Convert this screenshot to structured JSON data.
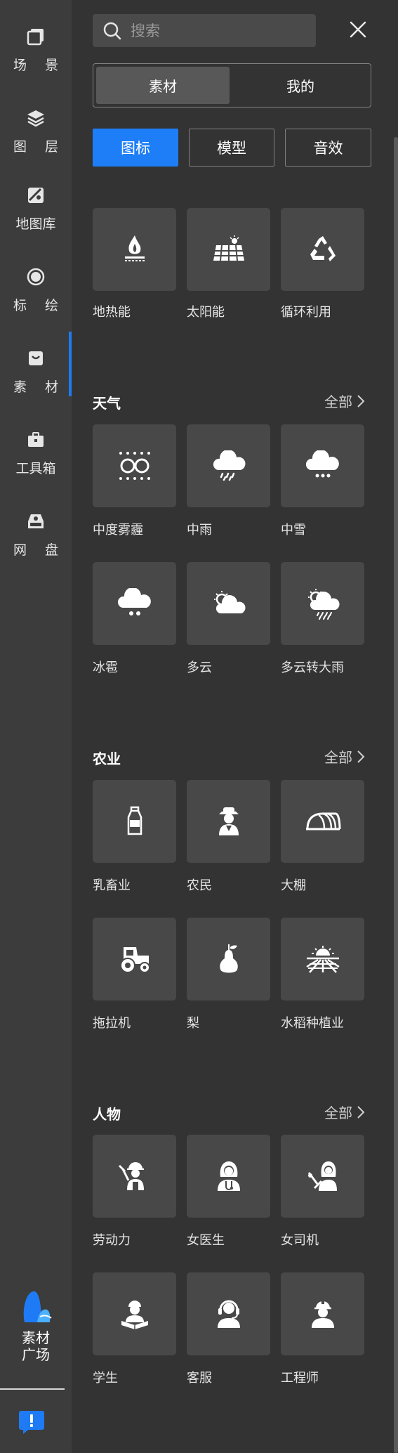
{
  "rail": {
    "items": [
      {
        "label": "场 景",
        "icon": "scene-icon"
      },
      {
        "label": "图 层",
        "icon": "layers-icon"
      },
      {
        "label": "地图库",
        "icon": "map-library-icon"
      },
      {
        "label": "标 绘",
        "icon": "plot-icon"
      },
      {
        "label": "素 材",
        "icon": "material-bag-icon",
        "active": true
      },
      {
        "label": "工具箱",
        "icon": "toolbox-icon"
      },
      {
        "label": "网 盘",
        "icon": "cloud-drive-icon"
      }
    ],
    "plaza": {
      "label_line1": "素材",
      "label_line2": "广场"
    },
    "accent_color": "#1e7bf5"
  },
  "search": {
    "placeholder": "搜索"
  },
  "segmented": {
    "options": [
      "素材",
      "我的"
    ],
    "selected": "素材"
  },
  "type_tabs": {
    "items": [
      "图标",
      "模型",
      "音效"
    ],
    "selected": "图标",
    "accent_color": "#1e7ef7"
  },
  "top_group": {
    "items": [
      {
        "label": "地热能",
        "icon": "geothermal-icon"
      },
      {
        "label": "太阳能",
        "icon": "solar-panel-icon"
      },
      {
        "label": "循环利用",
        "icon": "recycle-icon"
      }
    ]
  },
  "sections": [
    {
      "title": "天气",
      "all_label": "全部",
      "items": [
        {
          "label": "中度雾霾",
          "icon": "haze-icon"
        },
        {
          "label": "中雨",
          "icon": "moderate-rain-icon"
        },
        {
          "label": "中雪",
          "icon": "moderate-snow-icon"
        },
        {
          "label": "冰雹",
          "icon": "hail-icon"
        },
        {
          "label": "多云",
          "icon": "cloudy-icon"
        },
        {
          "label": "多云转大雨",
          "icon": "cloudy-to-heavy-rain-icon"
        }
      ]
    },
    {
      "title": "农业",
      "all_label": "全部",
      "items": [
        {
          "label": "乳畜业",
          "icon": "milk-bottle-icon"
        },
        {
          "label": "农民",
          "icon": "farmer-icon"
        },
        {
          "label": "大棚",
          "icon": "greenhouse-icon"
        },
        {
          "label": "拖拉机",
          "icon": "tractor-icon"
        },
        {
          "label": "梨",
          "icon": "pear-icon"
        },
        {
          "label": "水稻种植业",
          "icon": "rice-field-icon"
        }
      ]
    },
    {
      "title": "人物",
      "all_label": "全部",
      "items": [
        {
          "label": "劳动力",
          "icon": "laborer-icon"
        },
        {
          "label": "女医生",
          "icon": "female-doctor-icon"
        },
        {
          "label": "女司机",
          "icon": "female-driver-icon"
        },
        {
          "label": "学生",
          "icon": "student-icon"
        },
        {
          "label": "客服",
          "icon": "customer-service-icon"
        },
        {
          "label": "工程师",
          "icon": "engineer-icon"
        }
      ]
    }
  ]
}
